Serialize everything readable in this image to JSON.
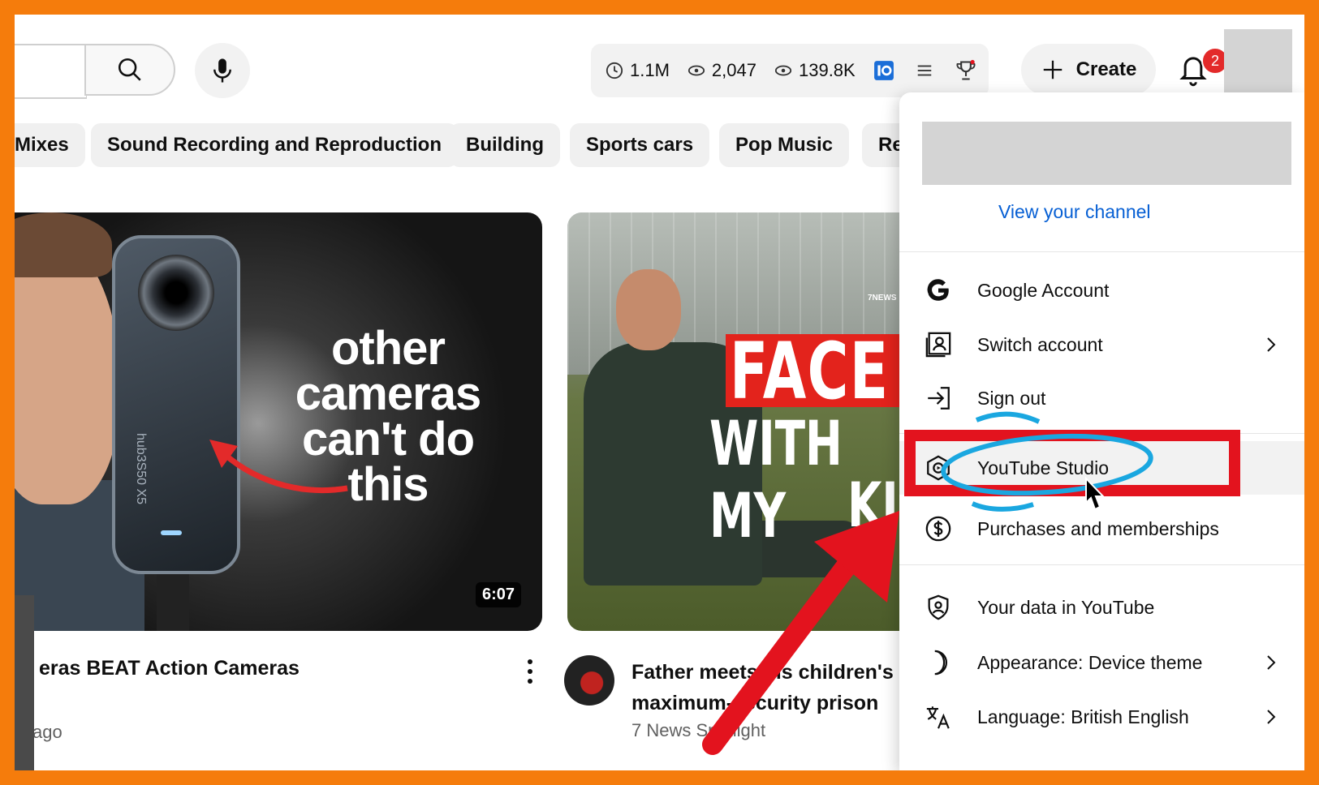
{
  "header": {
    "stats": [
      {
        "icon": "clock-icon",
        "value": "1.1M"
      },
      {
        "icon": "eye-icon",
        "value": "2,047"
      },
      {
        "icon": "eye-icon",
        "value": "139.8K"
      }
    ],
    "create_label": "Create",
    "notification_count": "2"
  },
  "chips": [
    "Mixes",
    "Sound Recording and Reproduction",
    "Building",
    "Sports cars",
    "Pop Music",
    "Re"
  ],
  "videos": [
    {
      "thumbnail_text": [
        "other",
        "cameras",
        "can't do",
        "this"
      ],
      "camera_label": "hub3S50 X5",
      "duration": "6:07",
      "title": "eras BEAT Action Cameras",
      "meta": "ago"
    },
    {
      "thumbnail_text_1": "FACE",
      "thumbnail_text_2": "WITH MY",
      "thumbnail_text_3": "KI",
      "news_logo": "7NEWS",
      "title": "Father meets his children's maximum-security prison",
      "channel": "7 News Spotlight"
    }
  ],
  "account_menu": {
    "view_channel": "View your channel",
    "items": [
      {
        "icon": "google-icon",
        "label": "Google Account",
        "has_submenu": false
      },
      {
        "icon": "switch-account-icon",
        "label": "Switch account",
        "has_submenu": true
      },
      {
        "icon": "sign-out-icon",
        "label": "Sign out",
        "has_submenu": false
      },
      {
        "icon": "youtube-studio-icon",
        "label": "YouTube Studio",
        "has_submenu": false
      },
      {
        "icon": "dollar-icon",
        "label": "Purchases and memberships",
        "has_submenu": false
      },
      {
        "icon": "shield-person-icon",
        "label": "Your data in YouTube",
        "has_submenu": false
      },
      {
        "icon": "moon-icon",
        "label": "Appearance: Device theme",
        "has_submenu": true
      },
      {
        "icon": "translate-icon",
        "label": "Language: British English",
        "has_submenu": true
      }
    ]
  },
  "colors": {
    "frame_border": "#f57c0c",
    "link": "#065fd4",
    "highlight_box": "#e3131e",
    "circle_scribble": "#1aa7e0"
  }
}
